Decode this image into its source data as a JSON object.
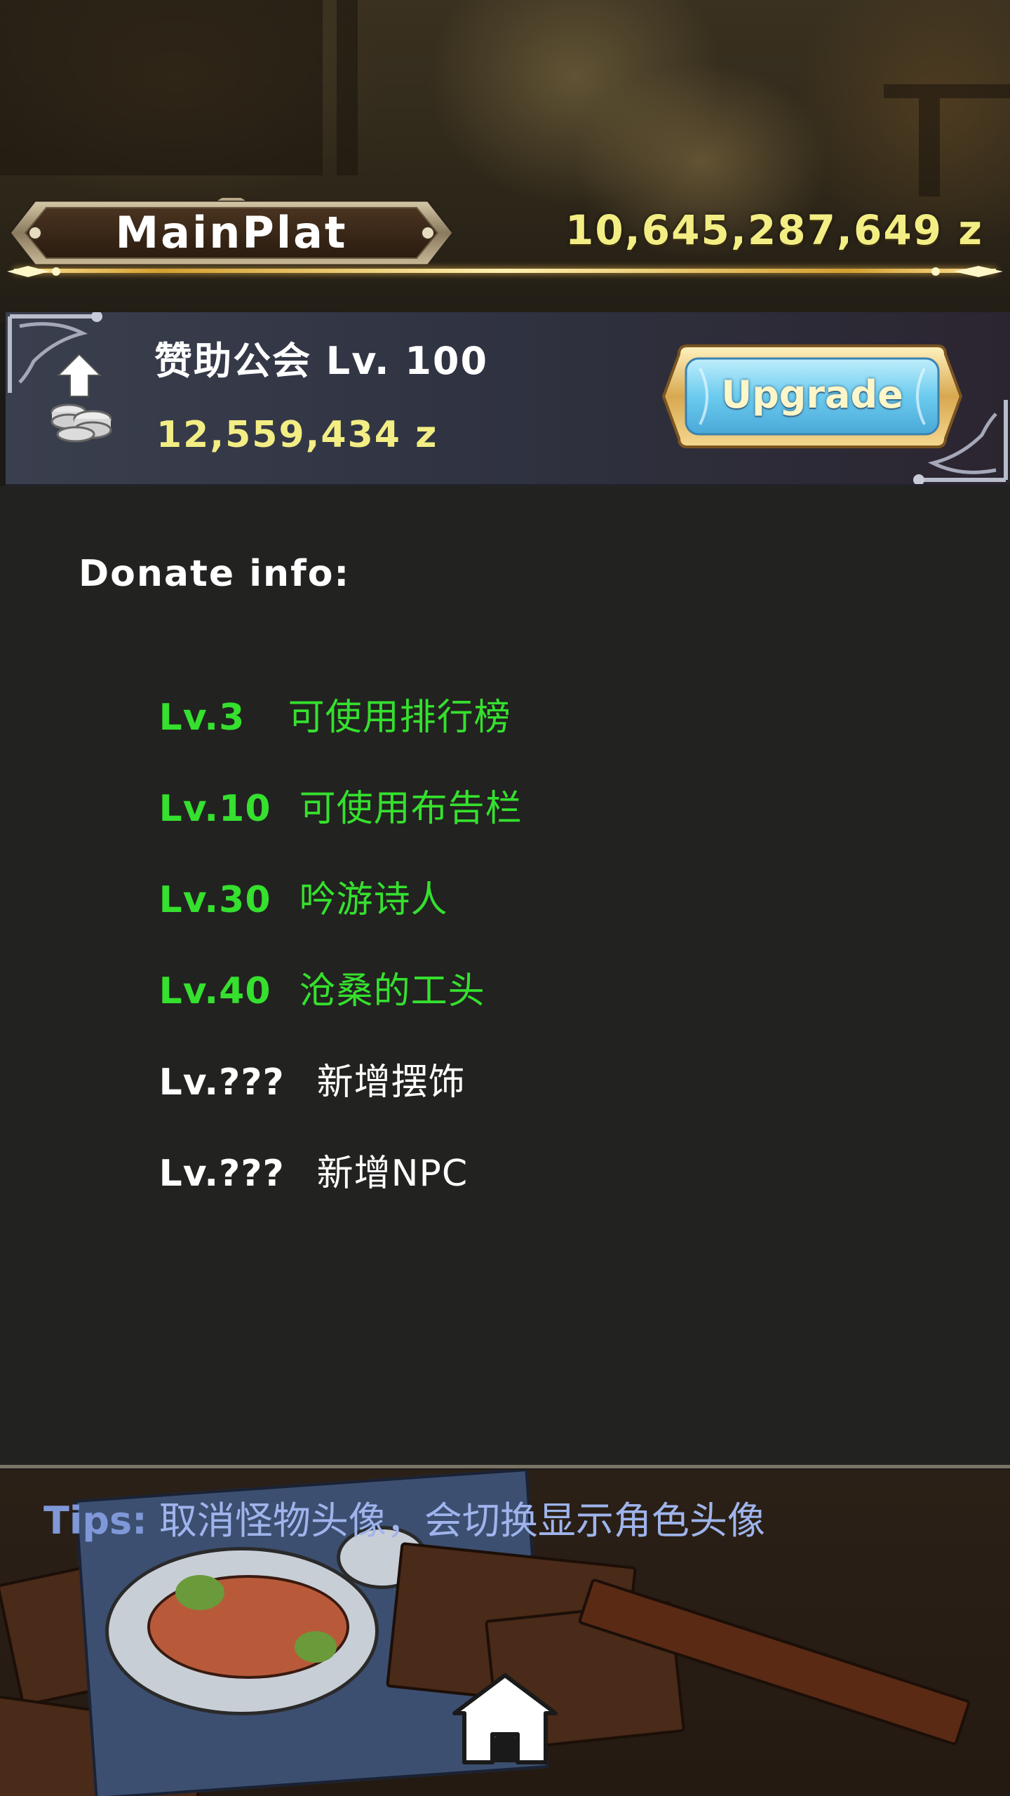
{
  "header": {
    "title": "MainPlat",
    "gold": "10,645,287,649 z"
  },
  "guild": {
    "name": "赞助公会 Lv. 100",
    "cost": "12,559,434 z",
    "icon": "coin-stack-upgrade-icon",
    "upgrade_label": "Upgrade"
  },
  "donate": {
    "title": "Donate info:",
    "items": [
      {
        "level": "Lv.3",
        "reward": "可使用排行榜",
        "unlocked": true
      },
      {
        "level": "Lv.10",
        "reward": "可使用布告栏",
        "unlocked": true
      },
      {
        "level": "Lv.30",
        "reward": "吟游诗人",
        "unlocked": true
      },
      {
        "level": "Lv.40",
        "reward": "沧桑的工头",
        "unlocked": true
      },
      {
        "level": "Lv.???",
        "reward": "新增摆饰",
        "unlocked": false
      },
      {
        "level": "Lv.???",
        "reward": "新增NPC",
        "unlocked": false
      }
    ]
  },
  "tips": {
    "label": "Tips:",
    "text": "取消怪物头像，会切换显示角色头像"
  },
  "nav": {
    "home_icon": "home-icon"
  },
  "colors": {
    "gold_text": "#f3ee84",
    "unlocked": "#35e02e",
    "locked": "#ffffff",
    "tips_label": "#7f98d8",
    "tips_text": "#9fb4ec",
    "upgrade_button": "#6cc8ee"
  }
}
